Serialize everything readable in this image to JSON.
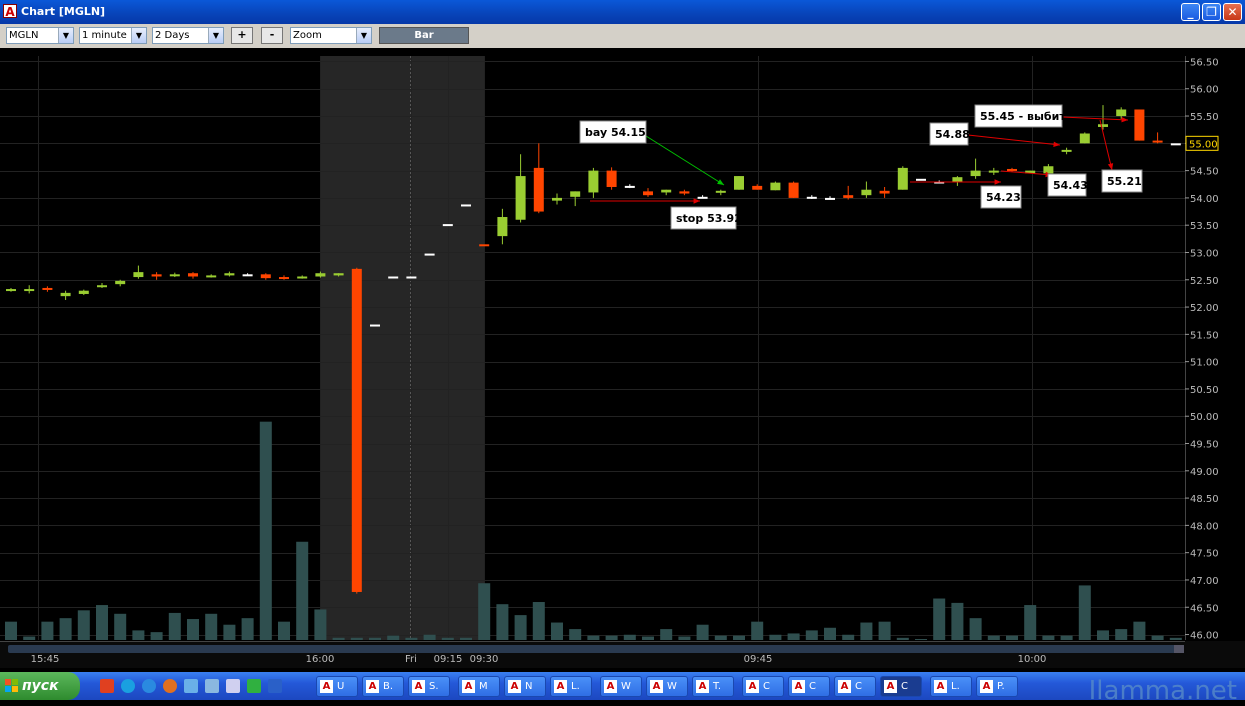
{
  "window": {
    "title": "Chart [MGLN]",
    "icon_letter": "A"
  },
  "toolbar": {
    "symbol": "MGLN",
    "interval": "1 minute",
    "range": "2 Days",
    "zoom_in_label": "+",
    "zoom_out_label": "-",
    "zoom_mode": "Zoom",
    "chart_type_label": "Bar"
  },
  "chart_data": {
    "type": "candlestick",
    "ylim": [
      45.9,
      56.6
    ],
    "y_ticks": [
      "56.50",
      "56.00",
      "55.50",
      "55.00",
      "54.50",
      "54.00",
      "53.50",
      "53.00",
      "52.50",
      "52.00",
      "51.50",
      "51.00",
      "50.50",
      "50.00",
      "49.50",
      "49.00",
      "48.50",
      "48.00",
      "47.50",
      "47.00",
      "46.50",
      "46.00"
    ],
    "current_price": "55.00",
    "x_labels": [
      "15:45",
      "16:00",
      "Fri",
      "09:15",
      "09:30",
      "09:45",
      "10:00"
    ],
    "colors": {
      "up": "#9acd32",
      "down": "#ff4500",
      "flat": "#ffffff",
      "volume": "#2f4f4f",
      "grid": "#222222",
      "session": "#262626"
    },
    "candles": [
      [
        52.3,
        52.35,
        52.28,
        52.33,
        "u"
      ],
      [
        52.33,
        52.4,
        52.25,
        52.32,
        "u"
      ],
      [
        52.35,
        52.38,
        52.28,
        52.32,
        "d"
      ],
      [
        52.26,
        52.3,
        52.13,
        52.2,
        "u"
      ],
      [
        52.24,
        52.32,
        52.22,
        52.3,
        "u"
      ],
      [
        52.38,
        52.44,
        52.35,
        52.4,
        "u"
      ],
      [
        52.42,
        52.5,
        52.38,
        52.48,
        "u"
      ],
      [
        52.55,
        52.76,
        52.52,
        52.64,
        "u"
      ],
      [
        52.6,
        52.64,
        52.5,
        52.56,
        "d"
      ],
      [
        52.58,
        52.63,
        52.55,
        52.6,
        "u"
      ],
      [
        52.62,
        52.64,
        52.52,
        52.56,
        "d"
      ],
      [
        52.57,
        52.6,
        52.54,
        52.58,
        "u"
      ],
      [
        52.58,
        52.65,
        52.56,
        52.62,
        "u"
      ],
      [
        52.6,
        52.62,
        52.57,
        52.6,
        "f"
      ],
      [
        52.6,
        52.62,
        52.5,
        52.53,
        "d"
      ],
      [
        52.55,
        52.58,
        52.5,
        52.53,
        "d"
      ],
      [
        52.54,
        52.58,
        52.52,
        52.56,
        "u"
      ],
      [
        52.56,
        52.65,
        52.54,
        52.62,
        "u"
      ],
      [
        52.58,
        52.62,
        52.56,
        52.62,
        "u"
      ],
      [
        52.7,
        52.72,
        46.75,
        46.78,
        "d"
      ],
      [
        51.68,
        51.68,
        51.68,
        51.68,
        "f"
      ],
      [
        52.56,
        52.56,
        52.56,
        52.56,
        "f"
      ],
      [
        52.56,
        52.56,
        52.56,
        52.56,
        "f"
      ],
      [
        52.98,
        52.98,
        52.98,
        52.98,
        "f"
      ],
      [
        53.52,
        53.52,
        53.52,
        53.52,
        "f"
      ],
      [
        53.88,
        53.88,
        53.88,
        53.88,
        "f"
      ],
      [
        53.15,
        53.15,
        53.15,
        53.15,
        "d"
      ],
      [
        53.3,
        53.8,
        53.15,
        53.65,
        "u"
      ],
      [
        53.6,
        54.8,
        53.55,
        54.4,
        "u"
      ],
      [
        54.55,
        55.0,
        53.72,
        53.75,
        "d"
      ],
      [
        53.95,
        54.08,
        53.88,
        54.0,
        "u"
      ],
      [
        54.02,
        54.12,
        53.85,
        54.12,
        "u"
      ],
      [
        54.1,
        54.55,
        54.0,
        54.5,
        "u"
      ],
      [
        54.5,
        54.56,
        54.15,
        54.2,
        "d"
      ],
      [
        54.22,
        54.25,
        54.18,
        54.22,
        "f"
      ],
      [
        54.12,
        54.18,
        54.02,
        54.05,
        "d"
      ],
      [
        54.1,
        54.15,
        54.05,
        54.15,
        "u"
      ],
      [
        54.12,
        54.15,
        54.05,
        54.08,
        "d"
      ],
      [
        54.02,
        54.05,
        54.0,
        54.02,
        "f"
      ],
      [
        54.1,
        54.15,
        54.05,
        54.13,
        "u"
      ],
      [
        54.15,
        54.4,
        54.15,
        54.4,
        "u"
      ],
      [
        54.22,
        54.25,
        54.15,
        54.15,
        "d"
      ],
      [
        54.28,
        54.3,
        54.14,
        54.14,
        "u"
      ],
      [
        54.28,
        54.3,
        54.0,
        54.0,
        "d"
      ],
      [
        54.02,
        54.05,
        53.98,
        54.0,
        "f"
      ],
      [
        54.0,
        54.03,
        53.97,
        54.0,
        "f"
      ],
      [
        54.0,
        54.22,
        53.97,
        54.05,
        "d"
      ],
      [
        54.05,
        54.3,
        54.0,
        54.15,
        "u"
      ],
      [
        54.13,
        54.2,
        54.0,
        54.08,
        "d"
      ],
      [
        54.15,
        54.58,
        54.15,
        54.55,
        "u"
      ],
      [
        54.35,
        54.35,
        54.35,
        54.35,
        "f"
      ],
      [
        54.3,
        54.32,
        54.28,
        54.3,
        "f"
      ],
      [
        54.3,
        54.4,
        54.22,
        54.38,
        "u"
      ],
      [
        54.4,
        54.72,
        54.35,
        54.5,
        "u"
      ],
      [
        54.5,
        54.55,
        54.42,
        54.5,
        "u"
      ],
      [
        54.53,
        54.55,
        54.48,
        54.5,
        "d"
      ],
      [
        54.45,
        54.5,
        54.45,
        54.5,
        "u"
      ],
      [
        54.45,
        54.62,
        54.45,
        54.58,
        "u"
      ],
      [
        54.85,
        54.92,
        54.8,
        54.88,
        "u"
      ],
      [
        55.0,
        55.2,
        55.0,
        55.18,
        "u"
      ],
      [
        55.3,
        55.7,
        55.25,
        55.35,
        "u"
      ],
      [
        55.5,
        55.66,
        55.45,
        55.62,
        "u"
      ],
      [
        55.62,
        55.62,
        55.05,
        55.05,
        "d"
      ],
      [
        55.05,
        55.2,
        55.0,
        55.05,
        "d"
      ],
      [
        55.0,
        55.0,
        55.0,
        55.0,
        "f"
      ]
    ],
    "volumes": [
      0.42,
      0.08,
      0.42,
      0.5,
      0.68,
      0.8,
      0.6,
      0.22,
      0.18,
      0.62,
      0.48,
      0.6,
      0.35,
      0.5,
      5.0,
      0.42,
      2.25,
      0.7,
      0.05,
      0.05,
      0.05,
      0.1,
      0.05,
      0.12,
      0.05,
      0.05,
      1.3,
      0.82,
      0.57,
      0.87,
      0.4,
      0.25,
      0.1,
      0.1,
      0.12,
      0.08,
      0.25,
      0.08,
      0.35,
      0.1,
      0.1,
      0.42,
      0.12,
      0.15,
      0.22,
      0.28,
      0.12,
      0.4,
      0.42,
      0.05,
      0.02,
      0.95,
      0.85,
      0.5,
      0.1,
      0.1,
      0.8,
      0.1,
      0.1,
      1.25,
      0.22,
      0.25,
      0.42,
      0.1,
      0.05
    ],
    "annotations": [
      {
        "label": "bay 54.15",
        "price": 54.15
      },
      {
        "label": "stop 53.92",
        "price": 53.92
      },
      {
        "label": "54.88",
        "price": 54.88
      },
      {
        "label": "55.45 - выбит",
        "price": 55.45
      },
      {
        "label": "54.23",
        "price": 54.23
      },
      {
        "label": "54.43",
        "price": 54.43
      },
      {
        "label": "55.21",
        "price": 55.21
      }
    ]
  },
  "taskbar": {
    "start_label": "пуск",
    "tasks": [
      {
        "label": "U"
      },
      {
        "label": "B."
      },
      {
        "label": "S."
      },
      {
        "label": "M"
      },
      {
        "label": "N"
      },
      {
        "label": "L."
      },
      {
        "label": "W"
      },
      {
        "label": "W"
      },
      {
        "label": "T."
      },
      {
        "label": "C"
      },
      {
        "label": "C"
      },
      {
        "label": "C"
      },
      {
        "label": "C"
      },
      {
        "label": "L."
      },
      {
        "label": "P."
      }
    ]
  },
  "watermark": "Ilamma.net"
}
